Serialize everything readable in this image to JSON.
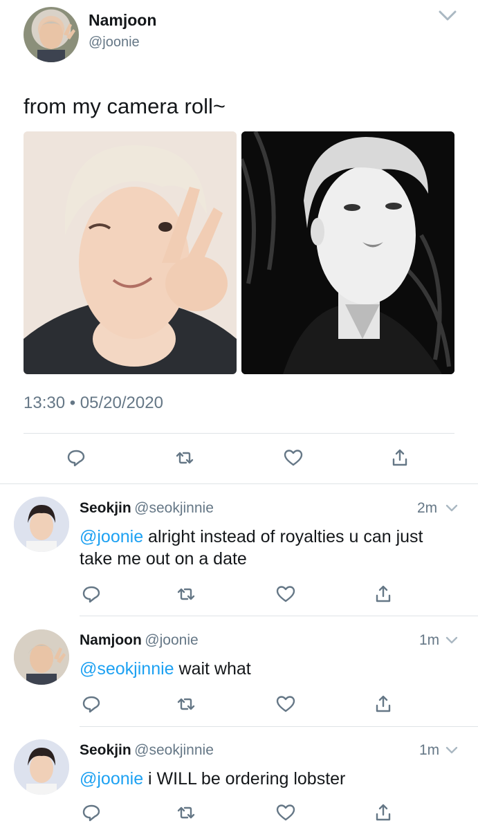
{
  "colors": {
    "link": "#1da1f2",
    "muted": "#657786",
    "divider": "#dfe3e6"
  },
  "tweet": {
    "author_name": "Namjoon",
    "author_handle": "@joonie",
    "text": "from my camera roll~",
    "timestamp": "13:30 • 05/20/2020",
    "photos": [
      {
        "name": "photo-selfie-wink",
        "style": "color"
      },
      {
        "name": "photo-selfie-bw",
        "style": "monochrome"
      }
    ],
    "actions": [
      "reply-icon",
      "retweet-icon",
      "like-icon",
      "share-icon"
    ]
  },
  "replies": [
    {
      "name": "Seokjin",
      "handle": "@seokjinnie",
      "time": "2m",
      "mention": "@joonie",
      "text": " alright instead of royalties u can just take me out on a date"
    },
    {
      "name": "Namjoon",
      "handle": "@joonie",
      "time": "1m",
      "mention": "@seokjinnie",
      "text": " wait what"
    },
    {
      "name": "Seokjin",
      "handle": "@seokjinnie",
      "time": "1m",
      "mention": "@joonie",
      "text": " i WILL be ordering lobster"
    }
  ]
}
